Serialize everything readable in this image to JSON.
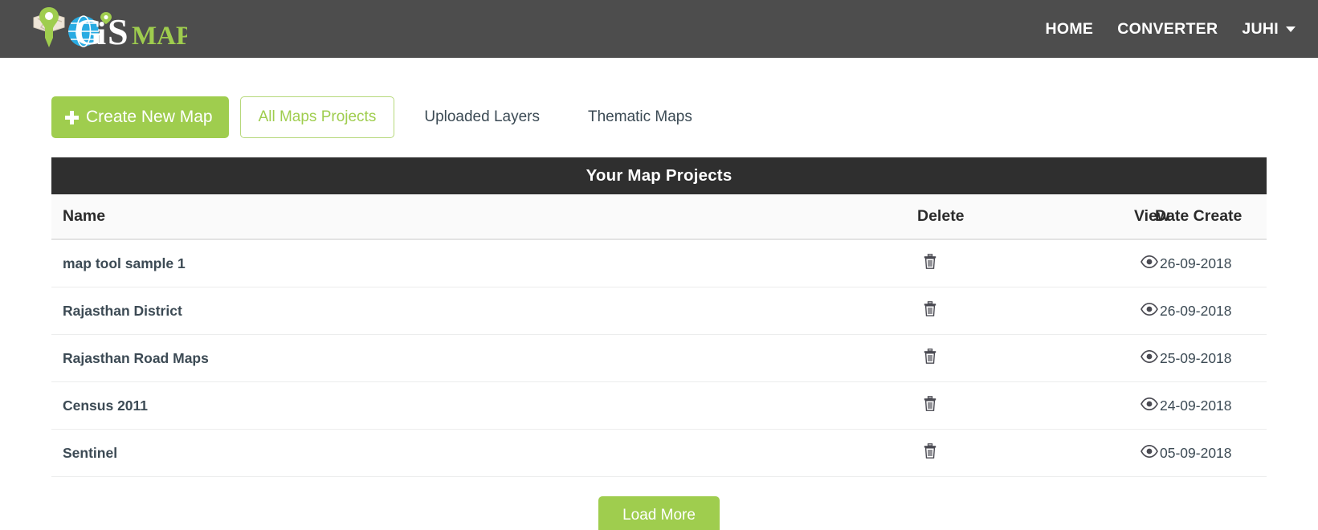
{
  "brand": {
    "name_gis": "GiS",
    "name_map": "MAP",
    "alt": "GIS MAP logo"
  },
  "nav": {
    "links": [
      {
        "label": "HOME"
      },
      {
        "label": "CONVERTER"
      }
    ],
    "user": {
      "label": "JUHI"
    }
  },
  "toolbar": {
    "create_label": "Create New Map",
    "tabs": [
      {
        "label": "All Maps Projects",
        "active": true
      },
      {
        "label": "Uploaded Layers",
        "active": false
      },
      {
        "label": "Thematic Maps",
        "active": false
      }
    ]
  },
  "panel": {
    "title": "Your Map Projects",
    "columns": [
      "Name",
      "View",
      "Delete",
      "Date Create"
    ],
    "rows": [
      {
        "name": "map tool sample 1",
        "date": "26-09-2018"
      },
      {
        "name": "Rajasthan District",
        "date": "26-09-2018"
      },
      {
        "name": "Rajasthan Road Maps",
        "date": "25-09-2018"
      },
      {
        "name": "Census 2011",
        "date": "24-09-2018"
      },
      {
        "name": "Sentinel",
        "date": "05-09-2018"
      }
    ]
  },
  "footer": {
    "load_more_label": "Load More"
  },
  "colors": {
    "green": "#9fcd4e",
    "navbar": "#4d4d4d",
    "panel_header": "#2f2f2f",
    "globe_blue": "#29abe2",
    "text_dark": "#3c4a54"
  }
}
